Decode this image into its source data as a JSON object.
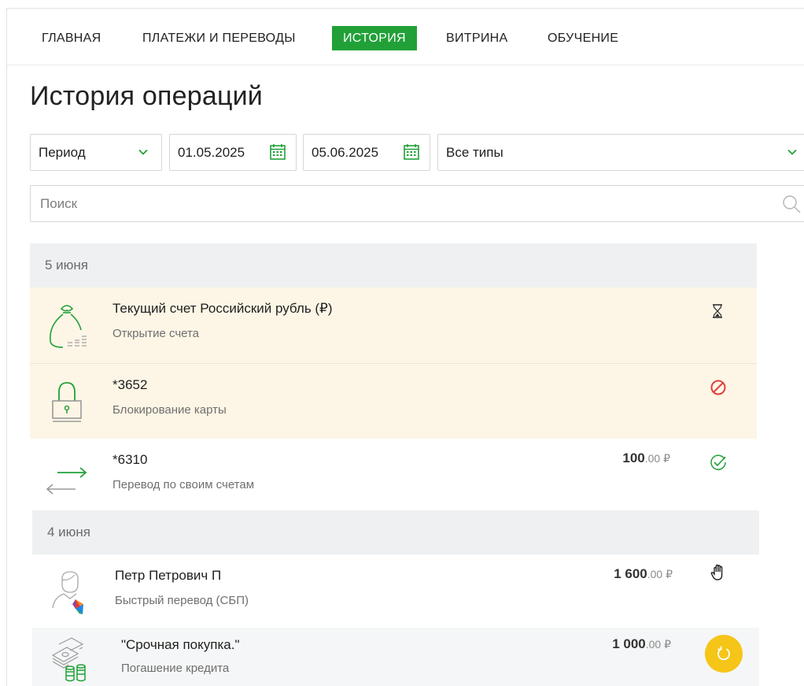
{
  "nav": {
    "items": [
      {
        "label": "ГЛАВНАЯ",
        "active": false
      },
      {
        "label": "ПЛАТЕЖИ И ПЕРЕВОДЫ",
        "active": false
      },
      {
        "label": "ИСТОРИЯ",
        "active": true
      },
      {
        "label": "ВИТРИНА",
        "active": false
      },
      {
        "label": "ОБУЧЕНИЕ",
        "active": false
      }
    ]
  },
  "page": {
    "title": "История операций"
  },
  "filters": {
    "period": "Период",
    "date_from": "01.05.2025",
    "date_to": "05.06.2025",
    "type": "Все типы"
  },
  "search": {
    "placeholder": "Поиск"
  },
  "history": {
    "groups": [
      {
        "date": "5 июня",
        "operations": [
          {
            "title": "Текущий счет  Российский рубль (₽)",
            "subtitle": "Открытие счета",
            "amount_int": "",
            "amount_dec": "",
            "status": "hourglass-icon"
          },
          {
            "title": "*3652",
            "subtitle": "Блокирование карты",
            "amount_int": "",
            "amount_dec": "",
            "status": "blocked-icon"
          },
          {
            "title": "*6310",
            "subtitle": "Перевод по своим счетам",
            "amount_int": "100",
            "amount_dec": ".00 ₽",
            "status": "check-circle-icon"
          }
        ]
      },
      {
        "date": "4 июня",
        "operations": [
          {
            "title": "Петр Петрович П",
            "subtitle": "Быстрый перевод (СБП)",
            "amount_int": "1 600",
            "amount_dec": ".00 ₽",
            "status": "hand-icon"
          },
          {
            "title": "\"Срочная покупка.\"",
            "subtitle": "Погашение кредита",
            "amount_int": "1 000",
            "amount_dec": ".00 ₽",
            "status": "repeat-icon"
          }
        ]
      }
    ]
  },
  "colors": {
    "accent": "#21a038",
    "warn_row": "#fdf6e6",
    "group_header": "#eef0f2",
    "error": "#e04040",
    "repeat_button": "#f5c518"
  }
}
